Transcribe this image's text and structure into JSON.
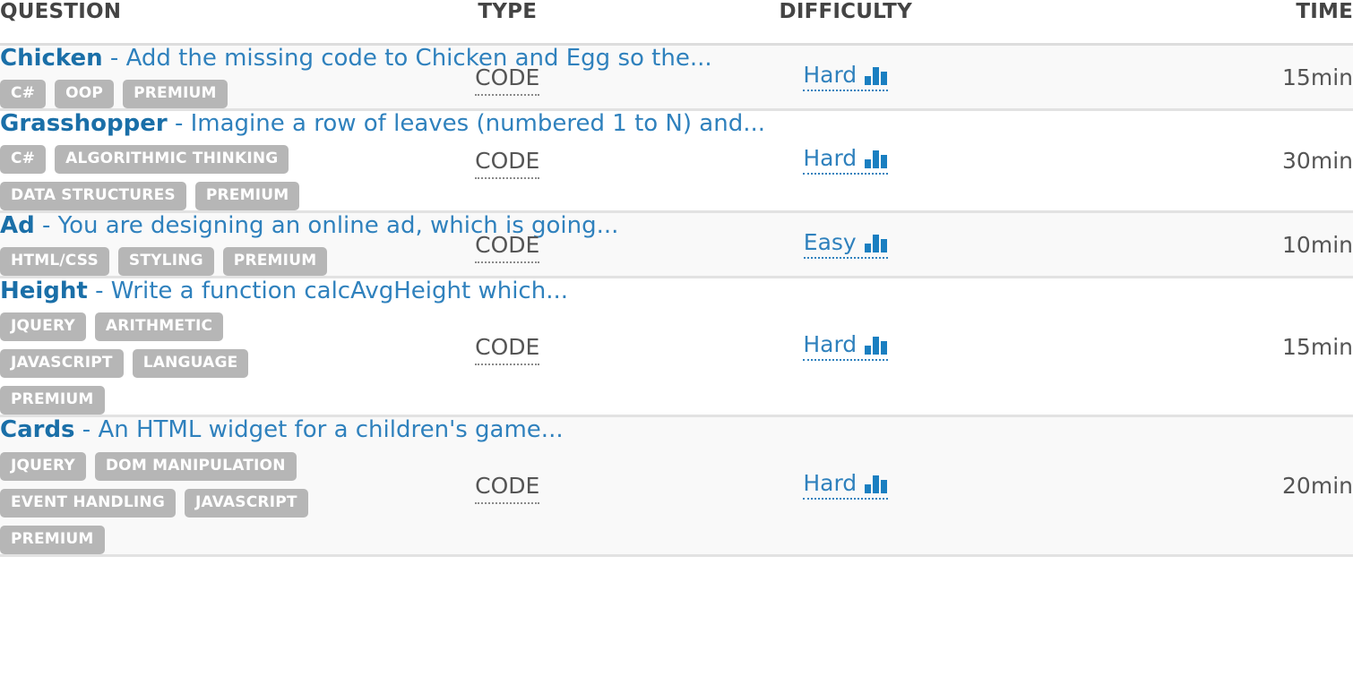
{
  "table": {
    "columns": [
      {
        "key": "question",
        "label": "QUESTION"
      },
      {
        "key": "type",
        "label": "TYPE"
      },
      {
        "key": "difficulty",
        "label": "DIFFICULTY"
      },
      {
        "key": "time",
        "label": "TIME"
      }
    ],
    "rows": [
      {
        "name": "Chicken",
        "separator": " - ",
        "description": "Add the missing code to Chicken and Egg so the...",
        "tags": [
          "C#",
          "OOP",
          "PREMIUM"
        ],
        "type": "CODE",
        "difficulty": "Hard",
        "difficulty_icon": "bar-chart-icon",
        "time": "15min"
      },
      {
        "name": "Grasshopper",
        "separator": " - ",
        "description": "Imagine a row of leaves (numbered 1 to N) and...",
        "tags": [
          "C#",
          "ALGORITHMIC THINKING",
          "DATA STRUCTURES",
          "PREMIUM"
        ],
        "type": "CODE",
        "difficulty": "Hard",
        "difficulty_icon": "bar-chart-icon",
        "time": "30min"
      },
      {
        "name": "Ad",
        "separator": " - ",
        "description": "You are designing an online ad, which is going...",
        "tags": [
          "HTML/CSS",
          "STYLING",
          "PREMIUM"
        ],
        "type": "CODE",
        "difficulty": "Easy",
        "difficulty_icon": "bar-chart-icon",
        "time": "10min"
      },
      {
        "name": "Height",
        "separator": " - ",
        "description": "Write a function calcAvgHeight which...",
        "tags": [
          "JQUERY",
          "ARITHMETIC",
          "JAVASCRIPT",
          "LANGUAGE",
          "PREMIUM"
        ],
        "type": "CODE",
        "difficulty": "Hard",
        "difficulty_icon": "bar-chart-icon",
        "time": "15min"
      },
      {
        "name": "Cards",
        "separator": " - ",
        "description": "An HTML widget for a children's game...",
        "tags": [
          "JQUERY",
          "DOM MANIPULATION",
          "EVENT HANDLING",
          "JAVASCRIPT",
          "PREMIUM"
        ],
        "type": "CODE",
        "difficulty": "Hard",
        "difficulty_icon": "bar-chart-icon",
        "time": "20min"
      }
    ]
  },
  "colors": {
    "link": "#2f81bd",
    "link_bold": "#1a6fa8",
    "tag_bg": "#b6b6b6",
    "tag_text": "#ffffff",
    "header_text": "#444444",
    "body_text": "#555555",
    "row_alt_bg": "#f9f9f9",
    "row_bg": "#ffffff",
    "row_border": "#e2e2e2",
    "header_border": "#dddddd",
    "icon_blue": "#1a7fc1"
  }
}
